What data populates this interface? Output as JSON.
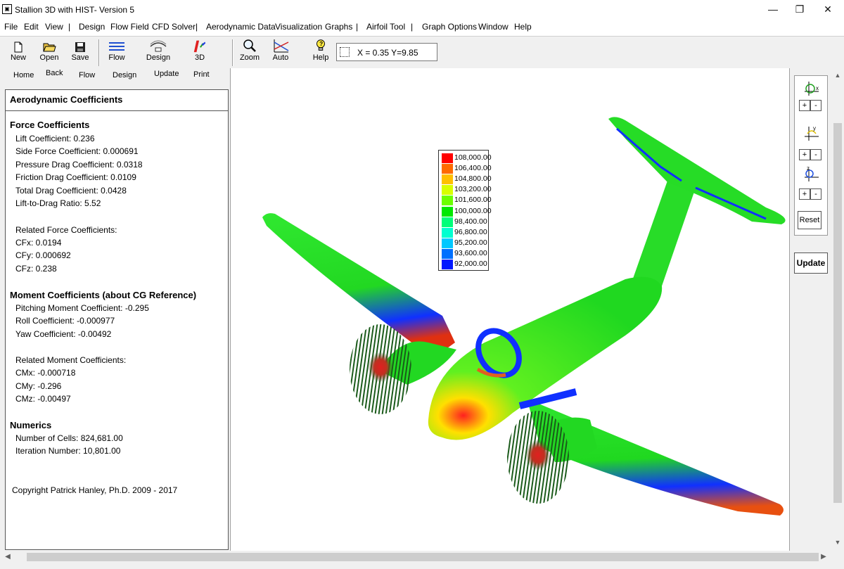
{
  "window": {
    "title": "Stallion 3D with HIST- Version 5",
    "app_icon": "stallion-app-icon",
    "minimize_icon": "minimize-icon",
    "restore_icon": "restore-icon",
    "close_icon": "close-icon"
  },
  "menu": {
    "file": "File",
    "edit": "Edit",
    "view": "View",
    "sep1": "|",
    "design": "Design",
    "flow_field": "Flow Field",
    "cfd_solver": "CFD Solver",
    "sep2": "|",
    "aero_data": "Aerodynamic Data",
    "visualization": "Visualization",
    "graphs": "Graphs",
    "sep3": "|",
    "airfoil_tool": "Airfoil Tool",
    "sep4": "|",
    "graph_options": "Graph Options",
    "window": "Window",
    "help": "Help"
  },
  "toolbar": {
    "new": "New",
    "open": "Open",
    "save": "Save",
    "flow": "Flow",
    "design": "Design",
    "threed": "3D",
    "zoom": "Zoom",
    "auto": "Auto",
    "help": "Help",
    "coord_readout": "X = 0.35  Y=9.85"
  },
  "nav": {
    "home": "Home",
    "back": "Back",
    "flow": "Flow",
    "design": "Design",
    "update": "Update",
    "print": "Print"
  },
  "coefficients": {
    "header": "Aerodynamic Coefficients",
    "force_title": "Force Coefficients",
    "lift": "Lift Coefficient: 0.236",
    "side": "Side Force Coefficient: 0.000691",
    "pressure_drag": "Pressure Drag Coefficient: 0.0318",
    "friction_drag": "Friction Drag Coefficient: 0.0109",
    "total_drag": "Total Drag Coefficient: 0.0428",
    "ld": "Lift-to-Drag Ratio: 5.52",
    "related_force_title": "Related Force Coefficients:",
    "cfx": "CFx: 0.0194",
    "cfy": "CFy: 0.000692",
    "cfz": "CFz: 0.238",
    "moment_title": "Moment Coefficients (about CG Reference)",
    "pitching": "Pitching Moment Coefficient: -0.295",
    "roll": "Roll Coefficient: -0.000977",
    "yaw": "Yaw Coefficient: -0.00492",
    "related_moment_title": "Related Moment Coefficients:",
    "cmx": "CMx: -0.000718",
    "cmy": "CMy: -0.296",
    "cmz": "CMz: -0.00497",
    "numerics_title": "Numerics",
    "cells": "Number of Cells: 824,681.00",
    "iterations": "Iteration Number: 10,801.00",
    "copyright": "Copyright Patrick Hanley, Ph.D. 2009 - 2017"
  },
  "legend": [
    {
      "label": "108,000.00",
      "color": "#ff0000"
    },
    {
      "label": "106,400.00",
      "color": "#ff6a00"
    },
    {
      "label": "104,800.00",
      "color": "#ffc000"
    },
    {
      "label": "103,200.00",
      "color": "#d8ff00"
    },
    {
      "label": "101,600.00",
      "color": "#6cff00"
    },
    {
      "label": "100,000.00",
      "color": "#00e800"
    },
    {
      "label": "98,400.00",
      "color": "#00ff7a"
    },
    {
      "label": "96,800.00",
      "color": "#00ffd0"
    },
    {
      "label": "95,200.00",
      "color": "#00c8ff"
    },
    {
      "label": "93,600.00",
      "color": "#0070ff"
    },
    {
      "label": "92,000.00",
      "color": "#0018ff"
    }
  ],
  "right_panel": {
    "x_axis": "x",
    "y_axis": "y",
    "z_axis": "z",
    "plus": "+",
    "minus": "-",
    "reset": "Reset",
    "update": "Update"
  }
}
